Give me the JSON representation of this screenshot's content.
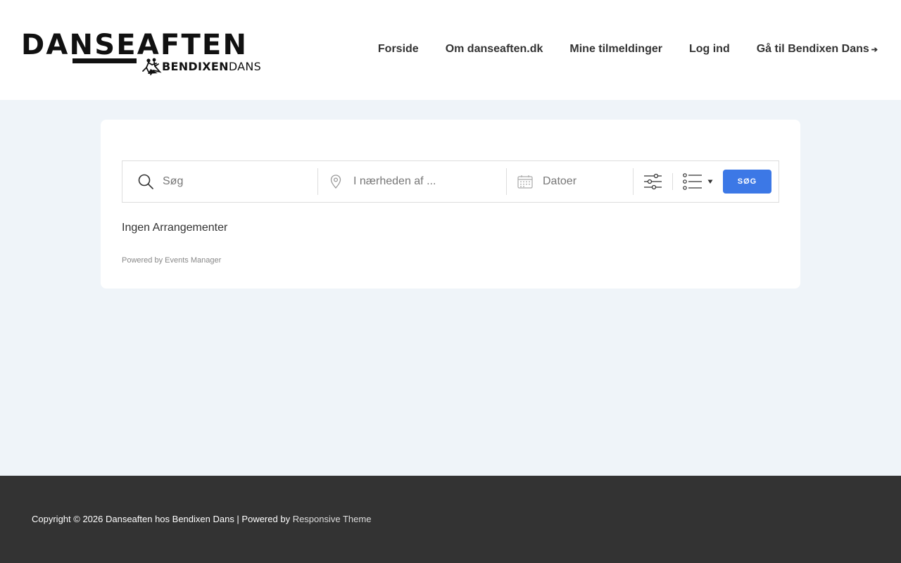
{
  "logo": {
    "main": "DANSEAFTEN",
    "sub_bold": "BENDIXEN",
    "sub_light": "DANS"
  },
  "nav": {
    "items": [
      {
        "label": "Forside"
      },
      {
        "label": "Om danseaften.dk"
      },
      {
        "label": "Mine tilmeldinger"
      },
      {
        "label": "Log ind"
      },
      {
        "label": "Gå til Bendixen Dans",
        "arrow": "➔"
      }
    ]
  },
  "search": {
    "query_placeholder": "Søg",
    "location_placeholder": "I nærheden af ...",
    "dates_placeholder": "Datoer",
    "submit_label": "SØG"
  },
  "results": {
    "empty_text": "Ingen Arrangementer"
  },
  "powered": {
    "prefix": "Powered by ",
    "link": "Events Manager"
  },
  "footer": {
    "copyright": "Copyright © 2026 Danseaften hos Bendixen Dans | Powered by ",
    "theme_link": "Responsive Theme"
  },
  "colors": {
    "accent": "#3c78e6",
    "page_bg": "#eff4f9",
    "footer_bg": "#333333"
  }
}
